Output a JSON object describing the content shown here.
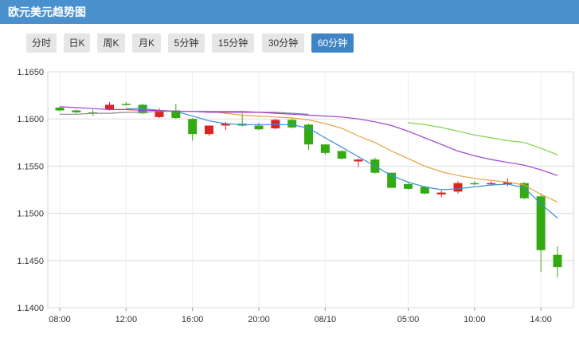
{
  "header": {
    "title": "欧元美元趋势图"
  },
  "tabs": [
    {
      "label": "分时",
      "active": false
    },
    {
      "label": "日K",
      "active": false
    },
    {
      "label": "周K",
      "active": false
    },
    {
      "label": "月K",
      "active": false
    },
    {
      "label": "5分钟",
      "active": false
    },
    {
      "label": "15分钟",
      "active": false
    },
    {
      "label": "30分钟",
      "active": false
    },
    {
      "label": "60分钟",
      "active": true
    }
  ],
  "colors": {
    "up": "#dd2222",
    "down": "#33aa11",
    "ma_blue": "#3a8fd6",
    "ma_orange": "#e8a044",
    "ma_purple": "#a13fcf",
    "ma_green": "#7fd14b",
    "ma_gray": "#888888"
  },
  "chart_data": {
    "type": "candlestick",
    "title": "",
    "xlabel": "",
    "ylabel": "",
    "ylim": [
      1.14,
      1.165
    ],
    "yticks": [
      "1.1650",
      "1.1600",
      "1.1550",
      "1.1500",
      "1.1450",
      "1.1400"
    ],
    "xticks": [
      "08:00",
      "12:00",
      "16:00",
      "20:00",
      "08/10",
      "05:00",
      "10:00",
      "14:00"
    ],
    "grid": true,
    "candles": [
      {
        "o": 1.1612,
        "h": 1.1613,
        "c": 1.1609,
        "l": 1.1608
      },
      {
        "o": 1.1609,
        "h": 1.161,
        "c": 1.1607,
        "l": 1.1606
      },
      {
        "o": 1.1607,
        "h": 1.161,
        "c": 1.1606,
        "l": 1.1603
      },
      {
        "o": 1.161,
        "h": 1.1618,
        "c": 1.1615,
        "l": 1.1609
      },
      {
        "o": 1.1616,
        "h": 1.1618,
        "c": 1.1615,
        "l": 1.1614
      },
      {
        "o": 1.1615,
        "h": 1.1616,
        "c": 1.1606,
        "l": 1.1605
      },
      {
        "o": 1.1602,
        "h": 1.1611,
        "c": 1.1609,
        "l": 1.1601
      },
      {
        "o": 1.1609,
        "h": 1.1616,
        "c": 1.1601,
        "l": 1.16
      },
      {
        "o": 1.16,
        "h": 1.1601,
        "c": 1.1584,
        "l": 1.1577
      },
      {
        "o": 1.1584,
        "h": 1.1593,
        "c": 1.1593,
        "l": 1.1582
      },
      {
        "o": 1.1593,
        "h": 1.1597,
        "c": 1.1595,
        "l": 1.1588
      },
      {
        "o": 1.1595,
        "h": 1.1606,
        "c": 1.1593,
        "l": 1.1592
      },
      {
        "o": 1.1593,
        "h": 1.1596,
        "c": 1.1589,
        "l": 1.1588
      },
      {
        "o": 1.159,
        "h": 1.16,
        "c": 1.1599,
        "l": 1.1589
      },
      {
        "o": 1.1599,
        "h": 1.16,
        "c": 1.1591,
        "l": 1.159
      },
      {
        "o": 1.1594,
        "h": 1.1595,
        "c": 1.1573,
        "l": 1.1567
      },
      {
        "o": 1.1573,
        "h": 1.1573,
        "c": 1.1564,
        "l": 1.1562
      },
      {
        "o": 1.1566,
        "h": 1.1567,
        "c": 1.1558,
        "l": 1.1557
      },
      {
        "o": 1.1555,
        "h": 1.1558,
        "c": 1.1557,
        "l": 1.1549
      },
      {
        "o": 1.1557,
        "h": 1.1559,
        "c": 1.1543,
        "l": 1.1542
      },
      {
        "o": 1.1543,
        "h": 1.1543,
        "c": 1.1527,
        "l": 1.1527
      },
      {
        "o": 1.1531,
        "h": 1.1532,
        "c": 1.1526,
        "l": 1.1525
      },
      {
        "o": 1.1528,
        "h": 1.1529,
        "c": 1.1521,
        "l": 1.152
      },
      {
        "o": 1.152,
        "h": 1.1524,
        "c": 1.1522,
        "l": 1.1517
      },
      {
        "o": 1.1523,
        "h": 1.1534,
        "c": 1.1532,
        "l": 1.1521
      },
      {
        "o": 1.1532,
        "h": 1.1534,
        "c": 1.1531,
        "l": 1.153
      },
      {
        "o": 1.1531,
        "h": 1.1534,
        "c": 1.1532,
        "l": 1.153
      },
      {
        "o": 1.1531,
        "h": 1.1537,
        "c": 1.1533,
        "l": 1.1529
      },
      {
        "o": 1.1532,
        "h": 1.1533,
        "c": 1.1516,
        "l": 1.1515
      },
      {
        "o": 1.1518,
        "h": 1.1521,
        "c": 1.1461,
        "l": 1.1438
      },
      {
        "o": 1.1456,
        "h": 1.1465,
        "c": 1.1443,
        "l": 1.1432
      }
    ],
    "ma_series": [
      {
        "color": "ma_blue",
        "values": [
          null,
          null,
          null,
          null,
          1.1611,
          1.1611,
          1.1609,
          1.1608,
          1.1603,
          1.1598,
          1.1595,
          1.1594,
          1.1594,
          1.1594,
          1.1594,
          1.159,
          1.158,
          1.157,
          1.156,
          1.155,
          1.154,
          1.1533,
          1.1528,
          1.1525,
          1.1526,
          1.1528,
          1.153,
          1.1531,
          1.1527,
          1.151,
          1.1495
        ]
      },
      {
        "color": "ma_orange",
        "values": [
          null,
          null,
          null,
          null,
          null,
          null,
          null,
          null,
          null,
          1.1608,
          1.1606,
          1.1604,
          1.1603,
          1.1602,
          1.1601,
          1.1599,
          1.1595,
          1.159,
          1.1582,
          1.1575,
          1.1566,
          1.1558,
          1.155,
          1.1544,
          1.154,
          1.1537,
          1.1535,
          1.1533,
          1.153,
          1.152,
          1.1512
        ]
      },
      {
        "color": "ma_purple",
        "values": [
          null,
          null,
          null,
          null,
          null,
          null,
          null,
          null,
          null,
          null,
          null,
          null,
          null,
          null,
          1.1605,
          1.1604,
          1.1603,
          1.1602,
          1.16,
          1.1597,
          1.1593,
          1.1587,
          1.158,
          1.1573,
          1.1566,
          1.1561,
          1.1557,
          1.1554,
          1.1551,
          1.1546,
          1.154
        ]
      },
      {
        "color": "ma_green",
        "values": [
          null,
          null,
          null,
          null,
          null,
          null,
          null,
          null,
          null,
          null,
          null,
          null,
          null,
          null,
          null,
          null,
          null,
          null,
          null,
          null,
          null,
          1.1596,
          1.1594,
          1.1591,
          1.1587,
          1.1583,
          1.158,
          1.1577,
          1.1575,
          1.1569,
          1.1562
        ]
      },
      {
        "color": "ma_gray",
        "values": [
          1.1605,
          1.1605,
          1.1606,
          1.1606,
          1.1607,
          1.1607,
          1.1608,
          1.1608,
          1.1608,
          1.1608,
          1.1608,
          1.1608,
          1.1607,
          1.1607,
          1.1606,
          1.1605,
          null,
          null,
          null,
          null,
          null,
          null,
          null,
          null,
          null,
          null,
          null,
          null,
          null,
          null,
          null
        ]
      },
      {
        "color": "ma_purple",
        "values": [
          1.1613,
          1.1612,
          1.1611,
          1.161,
          1.161,
          1.1609,
          1.1609,
          1.1608,
          1.1608,
          1.1607,
          1.1607,
          1.1607,
          1.1607,
          1.1606,
          1.1605,
          null,
          null,
          null,
          null,
          null,
          null,
          null,
          null,
          null,
          null,
          null,
          null,
          null,
          null,
          null,
          null
        ]
      }
    ]
  }
}
